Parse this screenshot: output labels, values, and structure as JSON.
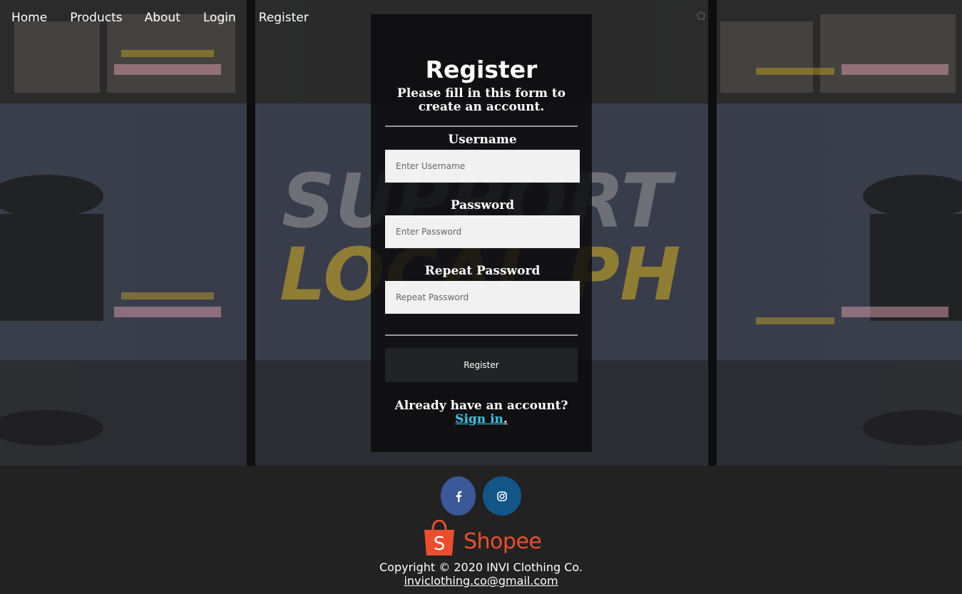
{
  "nav": {
    "items": [
      "Home",
      "Products",
      "About",
      "Login",
      "Register"
    ]
  },
  "background": {
    "art_line1": "SUPPORT",
    "art_line2": "LOCAL PH"
  },
  "form": {
    "title": "Register",
    "intro": "Please fill in this form to create an account.",
    "username_label": "Username",
    "username_placeholder": "Enter Username",
    "password_label": "Password",
    "password_placeholder": "Enter Password",
    "repeat_label": "Repeat Password",
    "repeat_placeholder": "Repeat Password",
    "submit_label": "Register",
    "signin_prompt": "Already have an account?",
    "signin_link": "Sign in",
    "signin_dot": "."
  },
  "footer": {
    "facebook_icon": "facebook-icon",
    "instagram_icon": "instagram-icon",
    "shopee_word": "Shopee",
    "shopee_letter": "S",
    "copyright": "Copyright © 2020 INVI Clothing Co.",
    "email": "inviclothing.co@gmail.com"
  },
  "colors": {
    "panel": "#0c0c0e",
    "link": "#39c6e6",
    "facebook": "#3b5998",
    "instagram": "#125688",
    "shopee": "#ee4d2d",
    "button": "#222324"
  }
}
